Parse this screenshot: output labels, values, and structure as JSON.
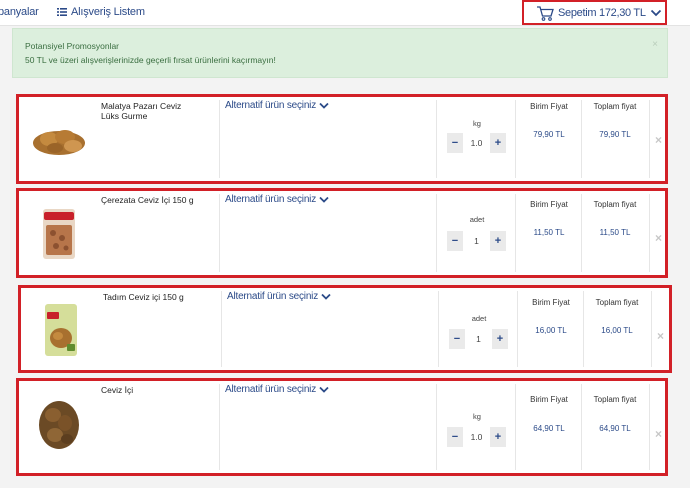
{
  "nav": {
    "campaigns_label": "panyalar",
    "shopping_list_label": "Alışveriş Listem"
  },
  "cart": {
    "label": "Sepetim 172,30 TL"
  },
  "promo": {
    "title": "Potansiyel Promosyonlar",
    "text": "50 TL ve üzeri alışverişlerinizde geçerli fırsat ürünlerini kaçırmayın!",
    "close": "×"
  },
  "columns": {
    "unit_price": "Birim Fiyat",
    "total_price": "Toplam fiyat"
  },
  "alt_label": "Alternatif ürün seçiniz",
  "items": [
    {
      "name": "Malatya Pazarı Ceviz Lüks Gurme",
      "unit": "kg",
      "qty": "1.0",
      "unit_price": "79,90 TL",
      "total_price": "79,90 TL"
    },
    {
      "name": "Çerezata Ceviz İçi 150 g",
      "unit": "adet",
      "qty": "1",
      "unit_price": "11,50 TL",
      "total_price": "11,50 TL"
    },
    {
      "name": "Tadım Ceviz içi 150 g",
      "unit": "adet",
      "qty": "1",
      "unit_price": "16,00 TL",
      "total_price": "16,00 TL"
    },
    {
      "name": "Ceviz İçi",
      "unit": "kg",
      "qty": "1.0",
      "unit_price": "64,90 TL",
      "total_price": "64,90 TL"
    }
  ],
  "stepper": {
    "minus": "−",
    "plus": "+"
  },
  "remove_label": "×",
  "colors": {
    "accent": "#2b4a88",
    "highlight_border": "#d22027",
    "promo_bg": "#dcefdd"
  }
}
